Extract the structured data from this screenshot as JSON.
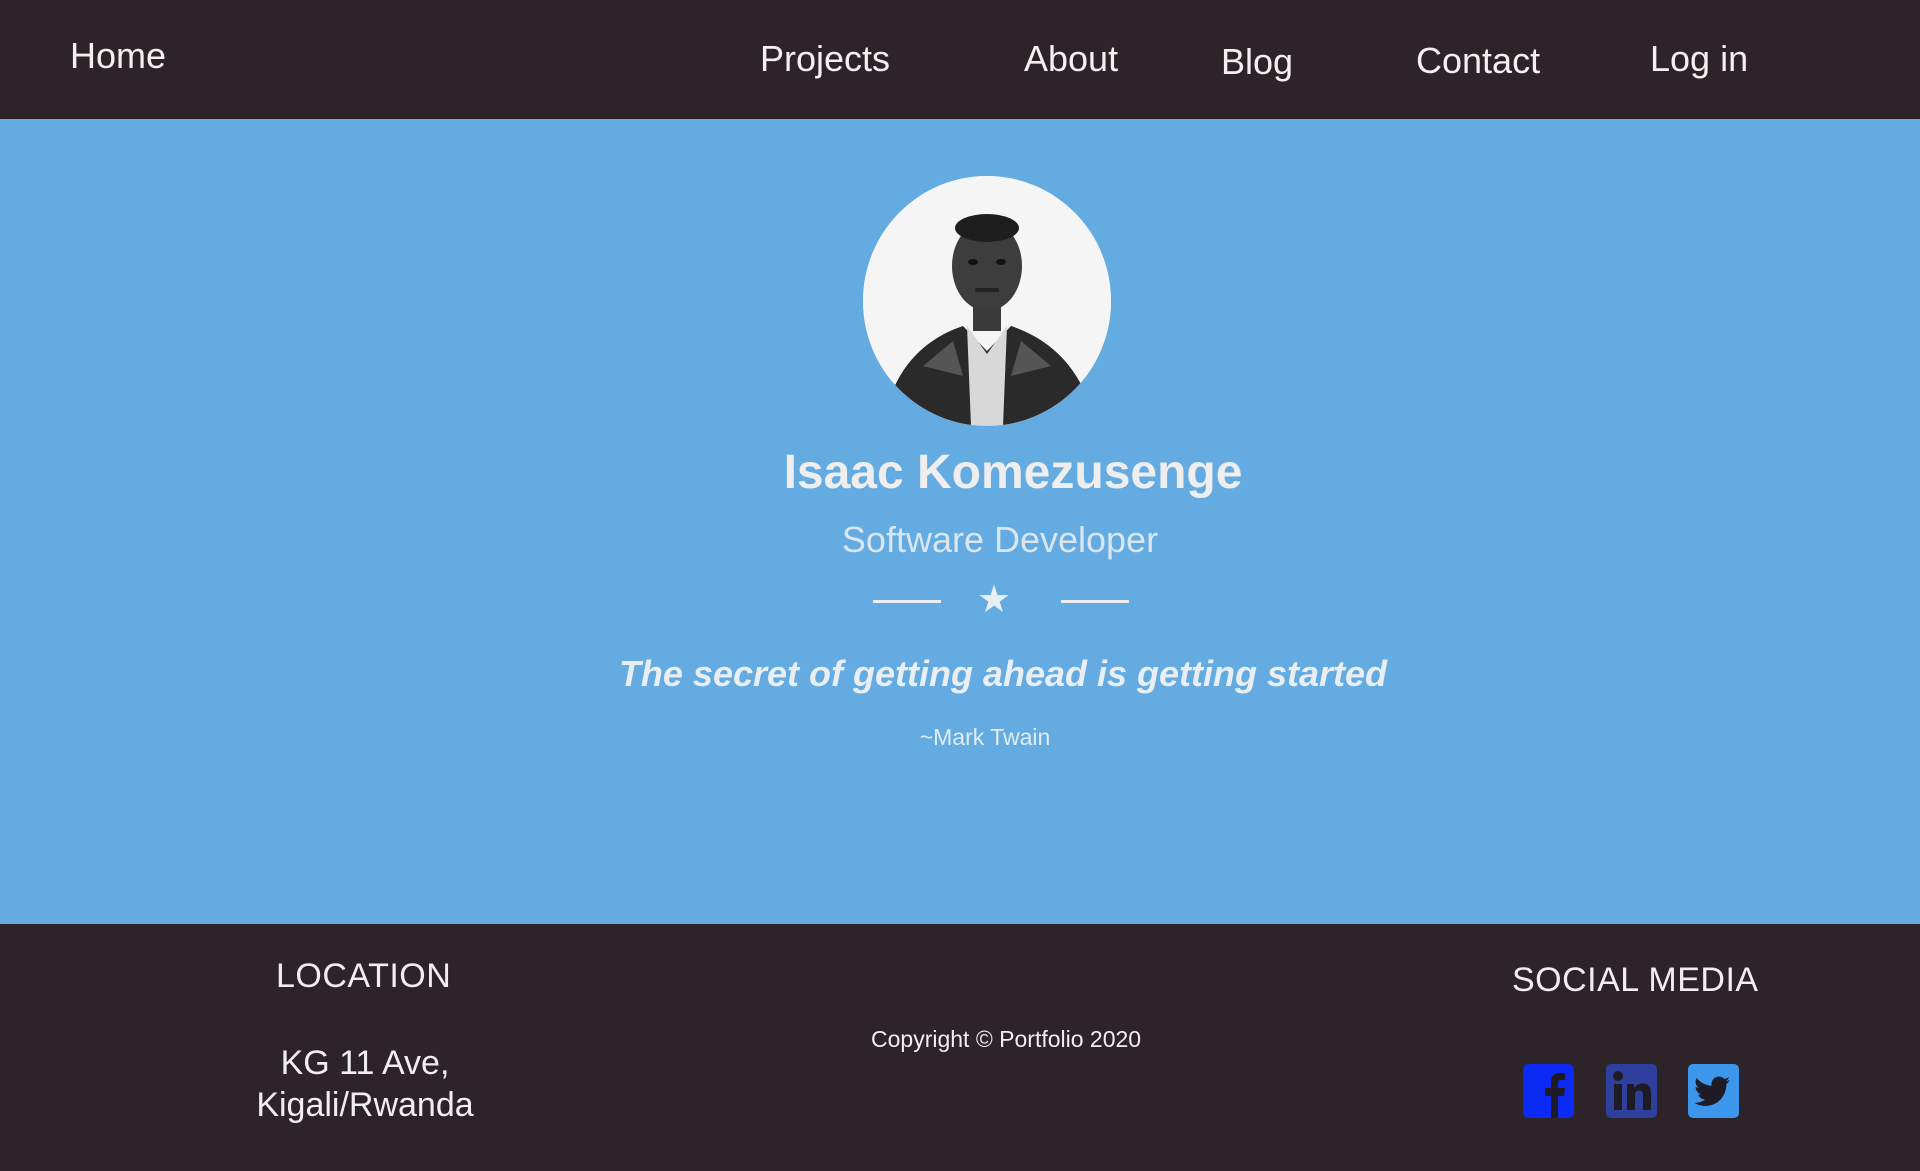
{
  "nav": {
    "home": "Home",
    "projects": "Projects",
    "about": "About",
    "blog": "Blog",
    "contact": "Contact",
    "login": "Log in"
  },
  "hero": {
    "name": "Isaac Komezusenge",
    "role": "Software Developer",
    "quote": "The secret of getting ahead is getting started",
    "quote_author": "~Mark Twain"
  },
  "footer": {
    "location_heading": "LOCATION",
    "address_line1": "KG 11 Ave,",
    "address_line2": "Kigali/Rwanda",
    "copyright": "Copyright © Portfolio 2020",
    "social_heading": "SOCIAL MEDIA",
    "social_icons": [
      "facebook-icon",
      "linkedin-icon",
      "twitter-icon"
    ]
  },
  "colors": {
    "nav_bg": "#2d2429",
    "hero_bg": "#63abe0",
    "footer_bg": "#2d2429",
    "facebook": "#0b2bf5",
    "linkedin": "#2f3f9e",
    "twitter": "#3b96ec"
  }
}
